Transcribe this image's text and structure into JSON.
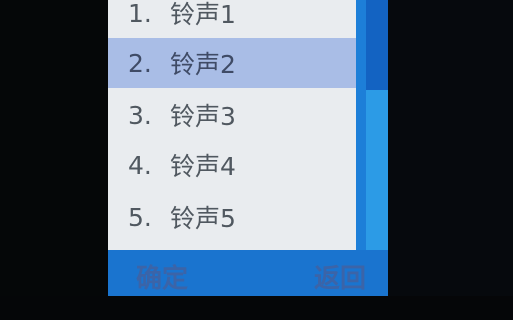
{
  "ringtone_list": {
    "items": [
      {
        "number": "1.",
        "label": "铃声1",
        "selected": false
      },
      {
        "number": "2.",
        "label": "铃声2",
        "selected": true
      },
      {
        "number": "3.",
        "label": "铃声3",
        "selected": false
      },
      {
        "number": "4.",
        "label": "铃声4",
        "selected": false
      },
      {
        "number": "5.",
        "label": "铃声5",
        "selected": false
      }
    ]
  },
  "softkeys": {
    "left_label": "确定",
    "right_label": "返回"
  },
  "colors": {
    "screen_bg": "#e9ecef",
    "selection_bg": "#a9bde6",
    "scrollbar": "#1d7fd8",
    "softkey_bar": "#1a74cf"
  }
}
